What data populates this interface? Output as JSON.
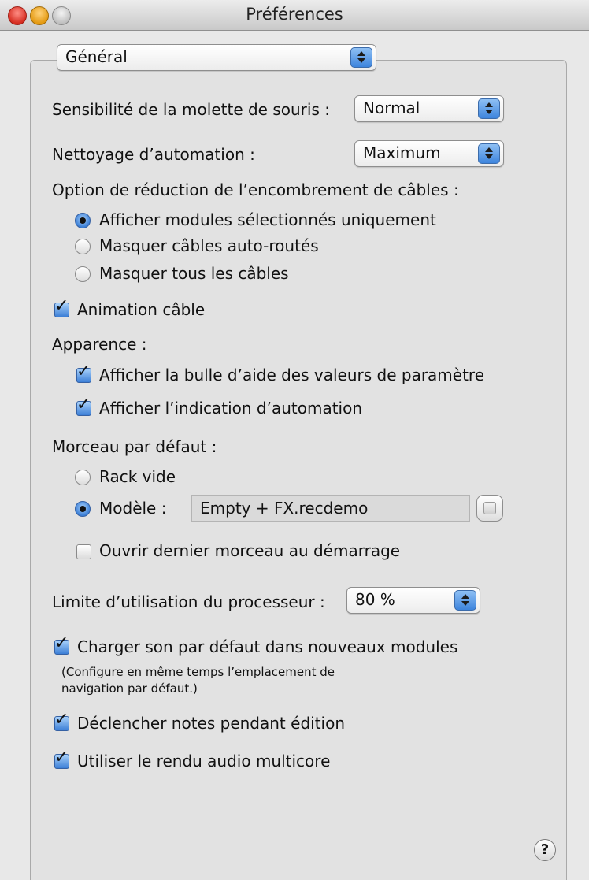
{
  "window": {
    "title": "Préférences"
  },
  "section_popup": {
    "value": "Général"
  },
  "mouse_wheel": {
    "label": "Sensibilité de la molette de souris :",
    "value": "Normal"
  },
  "automation_cleanup": {
    "label": "Nettoyage d’automation :",
    "value": "Maximum"
  },
  "cable_clutter": {
    "label": "Option de réduction de l’encombrement de câbles :",
    "options": [
      {
        "label": "Afficher modules sélectionnés uniquement",
        "selected": true
      },
      {
        "label": "Masquer câbles auto-routés",
        "selected": false
      },
      {
        "label": "Masquer tous les câbles",
        "selected": false
      }
    ]
  },
  "cable_animation": {
    "label": "Animation câble",
    "checked": true
  },
  "appearance": {
    "label": "Apparence :",
    "options": [
      {
        "label": "Afficher la bulle d’aide des valeurs de paramètre",
        "checked": true
      },
      {
        "label": "Afficher l’indication d’automation",
        "checked": true
      }
    ]
  },
  "default_song": {
    "label": "Morceau par défaut :",
    "empty_rack": {
      "label": "Rack vide",
      "selected": false
    },
    "template": {
      "label": "Modèle :",
      "selected": true,
      "value": "Empty + FX.recdemo"
    },
    "open_last": {
      "label": "Ouvrir dernier morceau au démarrage",
      "checked": false
    }
  },
  "cpu_limit": {
    "label": "Limite d’utilisation du processeur :",
    "value": "80 %"
  },
  "load_default_sound": {
    "label": "Charger son par défaut dans nouveaux modules",
    "note": "(Configure en même temps l’emplacement de navigation par défaut.)",
    "checked": true
  },
  "trigger_notes": {
    "label": "Déclencher notes pendant édition",
    "checked": true
  },
  "multicore": {
    "label": "Utiliser le rendu audio multicore",
    "checked": true
  },
  "help": {
    "glyph": "?"
  },
  "check_glyph": "✓"
}
